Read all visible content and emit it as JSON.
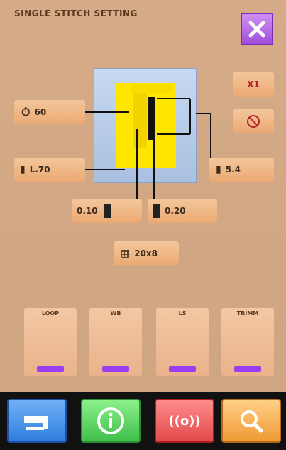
{
  "header": {
    "title": "SINGLE STITCH SETTING"
  },
  "top_right": {
    "close_icon": "close-icon"
  },
  "fields": {
    "speed": {
      "icon": "speed-icon",
      "value": "60"
    },
    "length": {
      "icon": "length-icon",
      "value": "L.70"
    },
    "left_offset": {
      "value": "0.10"
    },
    "right_offset": {
      "value": "0.20"
    },
    "stitch_count": {
      "value": "5.4"
    },
    "grid": {
      "value": "20x8"
    }
  },
  "right_panel": {
    "x1_label": "X1",
    "stop_icon": "stop-icon"
  },
  "thumbnails": [
    {
      "caption": "LOOP",
      "bar_label": ""
    },
    {
      "caption": "WB",
      "bar_label": ""
    },
    {
      "caption": "LS",
      "bar_label": ""
    },
    {
      "caption": "TRIMM",
      "bar_label": ""
    }
  ],
  "bottom_nav": {
    "machine_icon": "sewing-machine-icon",
    "info_icon": "info-icon",
    "alarm_icon": "alarm-icon",
    "search_icon": "search-icon"
  }
}
